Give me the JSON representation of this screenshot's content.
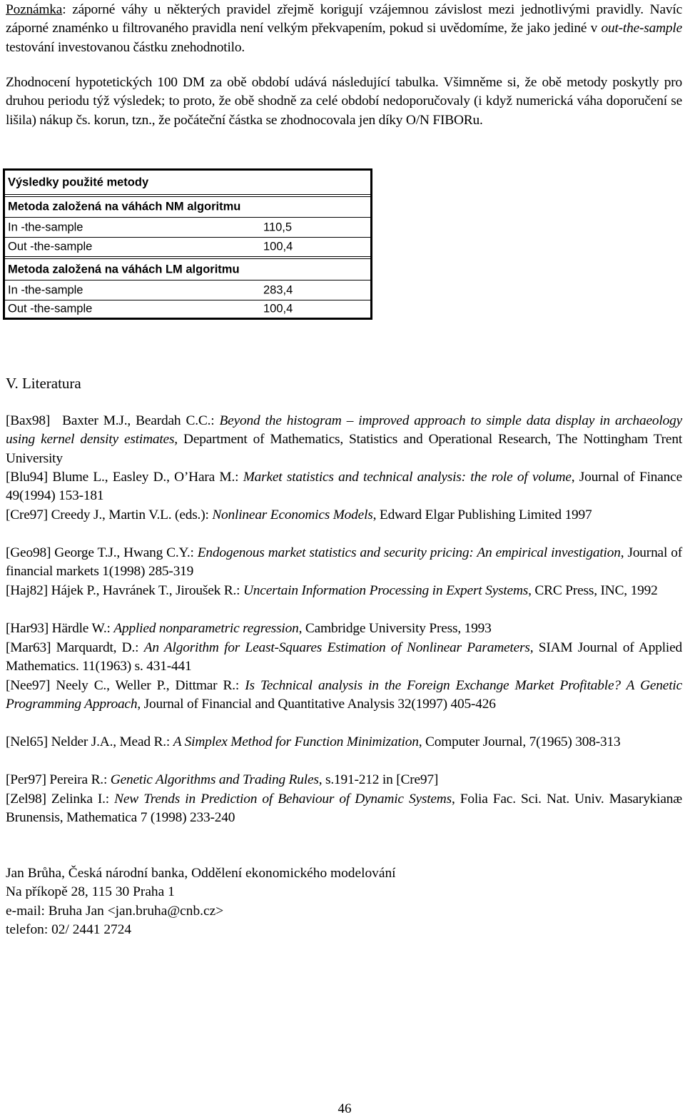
{
  "paragraphs": {
    "note_label": "Poznámka",
    "note_text_1": ": záporné váhy u některých pravidel zřejmě korigují vzájemnou závislost mezi jednotlivými pravidly. Navíc záporné znaménko u filtrovaného pravidla není velkým překvapením, pokud si uvědomíme, že jako jediné v ",
    "note_italic": "out-the-sample",
    "note_text_2": " testování investovanou částku znehodnotilo.",
    "evaluation": "Zhodnocení hypotetických 100 DM za obě období udává následující tabulka. Všimněme si, že obě metody poskytly pro druhou periodu týž výsledek; to proto, že obě shodně za celé období nedoporučovaly (i když numerická váha doporučení se lišila) nákup čs. korun, tzn., že počáteční částka se zhodnocovala jen díky O/N FIBORu."
  },
  "table": {
    "title": "Výsledky použité metody",
    "sections": [
      {
        "header": "Metoda založená na váhách NM algoritmu",
        "rows": [
          {
            "label": "In -the-sample",
            "value": "110,5"
          },
          {
            "label": "Out -the-sample",
            "value": "100,4"
          }
        ]
      },
      {
        "header": "Metoda založená na váhách LM algoritmu",
        "rows": [
          {
            "label": "In -the-sample",
            "value": "283,4"
          },
          {
            "label": "Out -the-sample",
            "value": "100,4"
          }
        ]
      }
    ]
  },
  "literature": {
    "heading": "V. Literatura",
    "refs": [
      {
        "key": "[Bax98]",
        "authors": "Baxter M.J., Beardah C.C.: ",
        "title": "Beyond the histogram – improved approach to simple data display in archaeology using kernel density estimates,",
        "rest": " Department of Mathematics, Statistics and Operational Research, The Nottingham Trent University"
      },
      {
        "key": "[Blu94]",
        "authors": "Blume L., Easley D., O’Hara M.: ",
        "title": "Market statistics and technical analysis: the role of volume",
        "rest": ", Journal of Finance 49(1994) 153-181"
      },
      {
        "key": "[Cre97]",
        "authors": "Creedy J., Martin V.L. (eds.): ",
        "title": "Nonlinear Economics Models",
        "rest": ", Edward Elgar Publishing Limited 1997"
      },
      {
        "key": "[Geo98]",
        "authors": "George T.J., Hwang C.Y.: ",
        "title": "Endogenous market statistics and security pricing: An empirical investigation",
        "rest": ", Journal of financial markets 1(1998) 285-319"
      },
      {
        "key": "[Haj82]",
        "authors": "Hájek P., Havránek T., Jiroušek R.: ",
        "title": "Uncertain Information Processing in Expert Systems",
        "rest": ", CRC Press, INC, 1992"
      },
      {
        "key": "[Har93]",
        "authors": "Härdle W.: ",
        "title": "Applied nonparametric regression",
        "rest": ", Cambridge University Press, 1993"
      },
      {
        "key": "[Mar63]",
        "authors": "Marquardt, D.: ",
        "title": "An Algorithm for Least-Squares Estimation of Nonlinear Parameters,",
        "rest": " SIAM Journal of Applied Mathematics. 11(1963) s. 431-441"
      },
      {
        "key": "[Nee97]",
        "authors": "Neely C., Weller P., Dittmar R.: ",
        "title": "Is Technical analysis in the Foreign Exchange Market Profitable? A Genetic Programming Approach",
        "rest": ", Journal of Financial and Quantitative Analysis 32(1997) 405-426"
      },
      {
        "key": "[Nel65]",
        "authors": "Nelder J.A., Mead R.: ",
        "title": "A Simplex Method for Function Minimization",
        "rest": ", Computer Journal, 7(1965) 308-313"
      },
      {
        "key": "[Per97]",
        "authors": "Pereira R.: ",
        "title": "Genetic Algorithms and Trading Rules",
        "rest": ", s.191-212 in [Cre97]"
      },
      {
        "key": "[Zel98]",
        "authors": "Zelinka I.: ",
        "title": "New Trends in Prediction of Behaviour of Dynamic Systems",
        "rest": ", Folia Fac. Sci. Nat. Univ. Masarykianæ Brunensis, Mathematica 7 (1998) 233-240"
      }
    ]
  },
  "contact": {
    "line1": "Jan Brůha,  Česká národní banka, Oddělení ekonomického modelování",
    "line2": "Na příkopě 28, 115 30 Praha 1",
    "line3": "e-mail: Bruha Jan <jan.bruha@cnb.cz>",
    "line4": "telefon: 02/ 2441 2724"
  },
  "page_number": "46"
}
